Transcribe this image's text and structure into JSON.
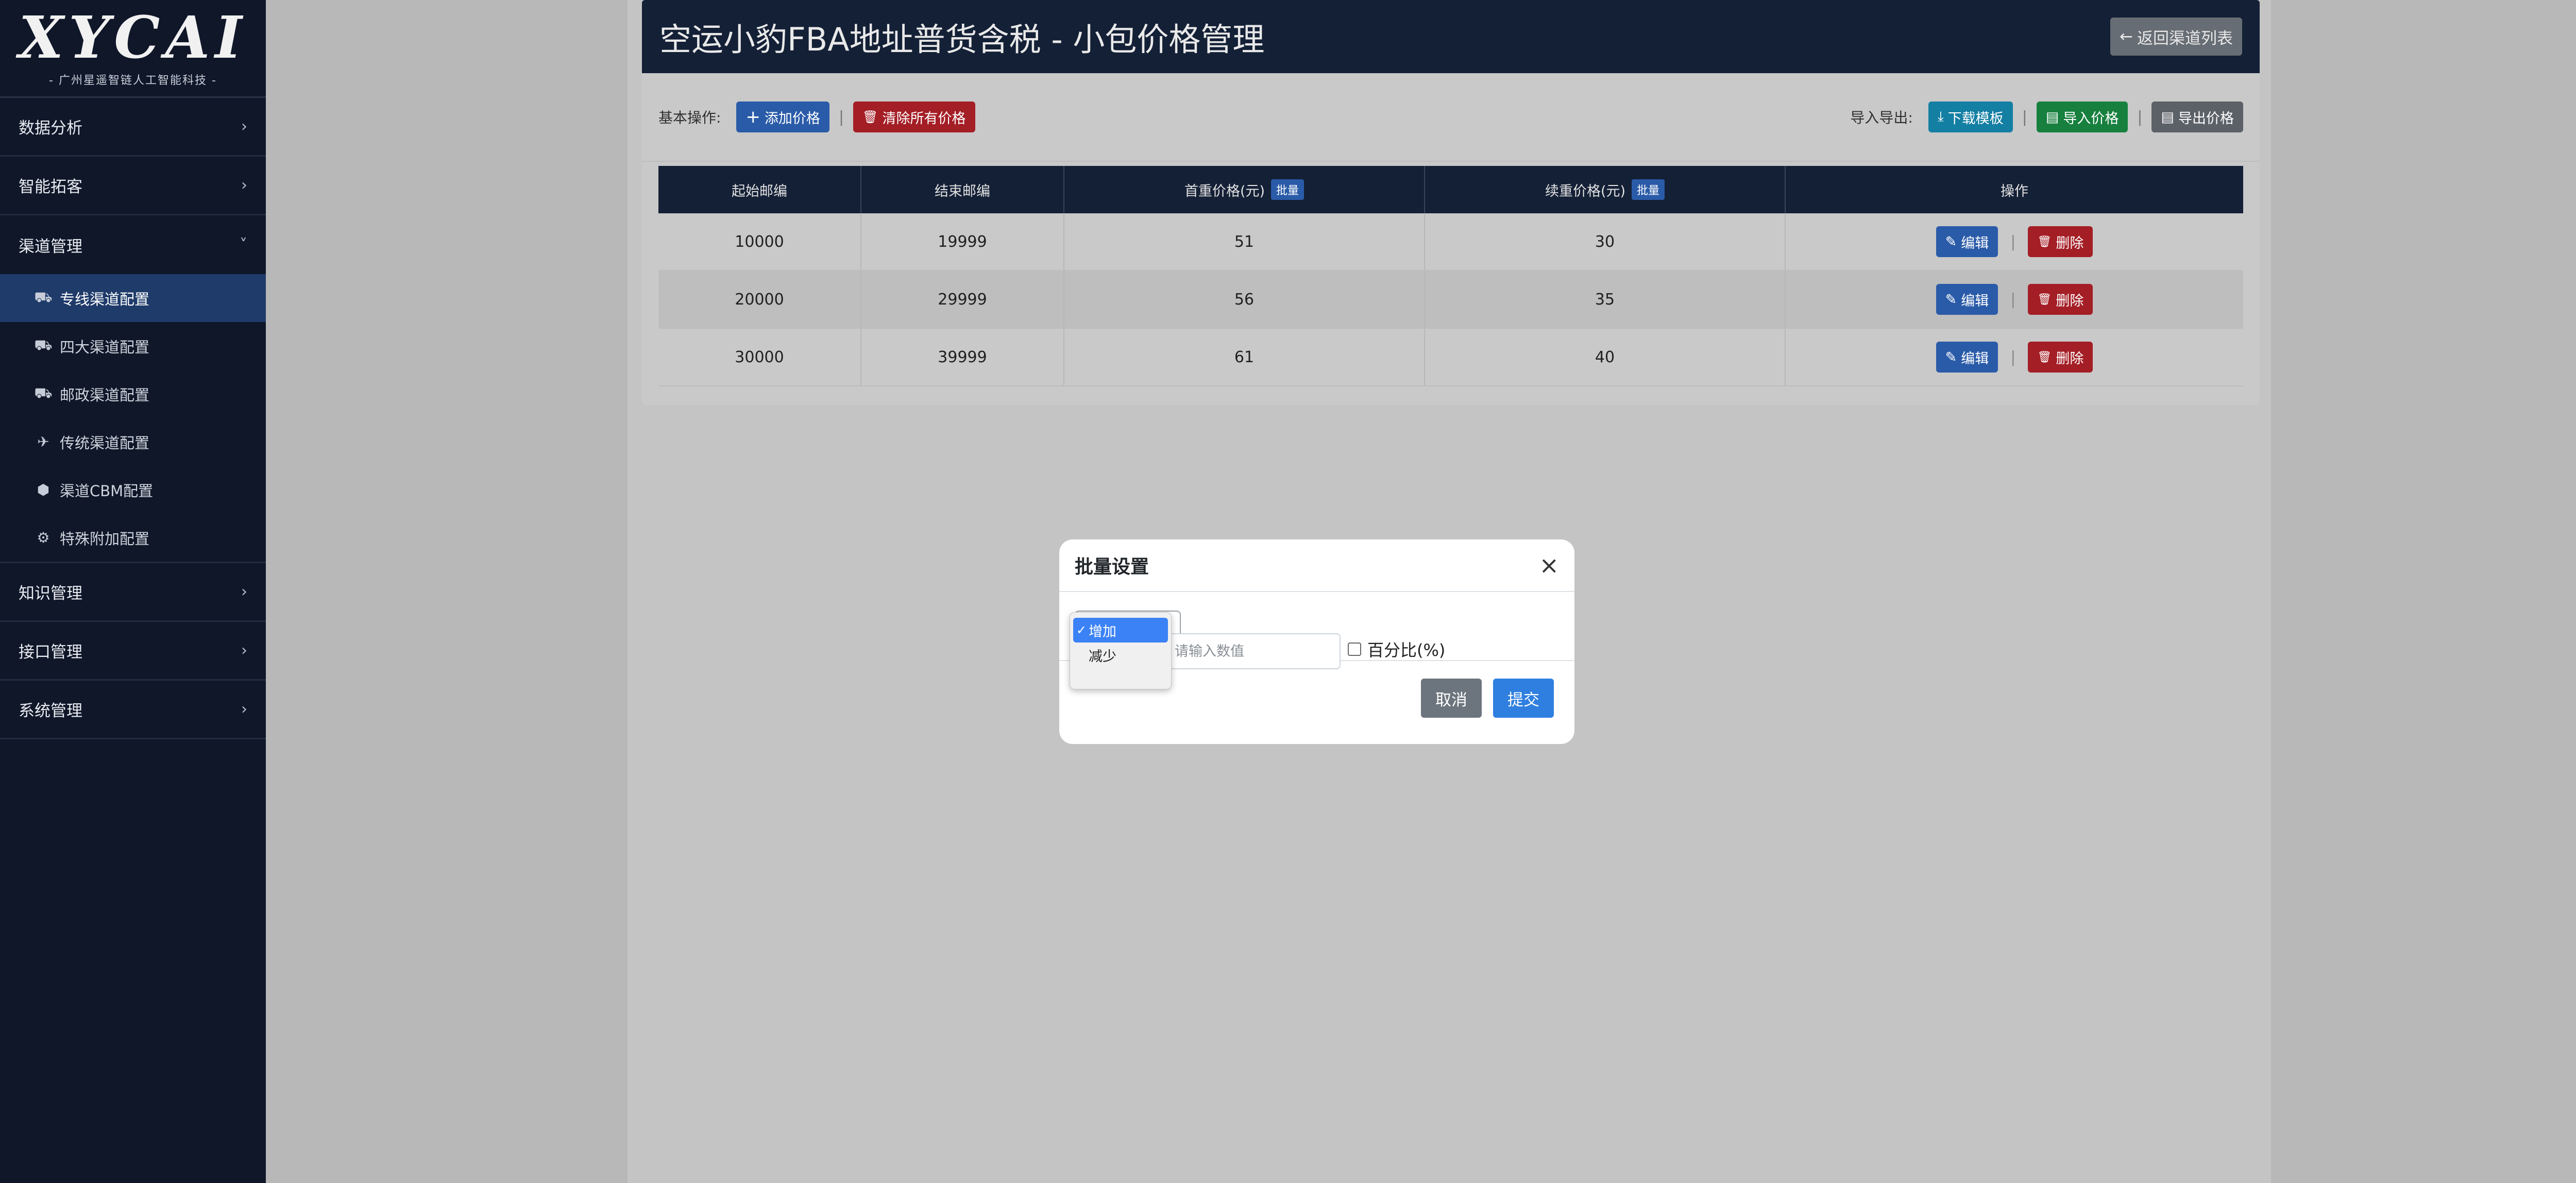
{
  "sidebar": {
    "logo": "XYCAI",
    "logo_sub": "- 广州星遥智链人工智能科技 -",
    "groups": [
      {
        "label": "数据分析",
        "chevron": "›"
      },
      {
        "label": "智能拓客",
        "chevron": "›"
      },
      {
        "label": "渠道管理",
        "chevron": "˅"
      }
    ],
    "channel_items": [
      {
        "label": "专线渠道配置",
        "icon": "truck-icon",
        "glyph": "⛟"
      },
      {
        "label": "四大渠道配置",
        "icon": "truck-icon",
        "glyph": "⛟"
      },
      {
        "label": "邮政渠道配置",
        "icon": "truck-icon",
        "glyph": "⛟"
      },
      {
        "label": "传统渠道配置",
        "icon": "plane-icon",
        "glyph": "✈"
      },
      {
        "label": "渠道CBM配置",
        "icon": "cube-icon",
        "glyph": "⬢"
      },
      {
        "label": "特殊附加配置",
        "icon": "gear-icon",
        "glyph": "⚙"
      }
    ],
    "groups_after": [
      {
        "label": "知识管理",
        "chevron": "›"
      },
      {
        "label": "接口管理",
        "chevron": "›"
      },
      {
        "label": "系统管理",
        "chevron": "›"
      }
    ]
  },
  "header": {
    "title": "空运小豹FBA地址普货含税 - 小包价格管理",
    "back_label": "返回渠道列表",
    "back_icon": "←"
  },
  "toolbar": {
    "basic_label": "基本操作:",
    "add_label": "添加价格",
    "add_icon": "+",
    "clear_label": "清除所有价格",
    "clear_icon": "🗑",
    "io_label": "导入导出:",
    "download_label": "下载模板",
    "download_icon": "⤓",
    "import_label": "导入价格",
    "import_icon": "▤",
    "export_label": "导出价格",
    "export_icon": "▤",
    "sep": "|"
  },
  "table": {
    "headers": [
      "起始邮编",
      "结束邮编",
      "首重价格(元)",
      "续重价格(元)",
      "操作"
    ],
    "batch_badge": "批量",
    "rows": [
      [
        "10000",
        "19999",
        "51",
        "30"
      ],
      [
        "20000",
        "29999",
        "56",
        "35"
      ],
      [
        "30000",
        "39999",
        "61",
        "40"
      ]
    ],
    "edit_label": "编辑",
    "edit_icon": "✎",
    "delete_label": "删除",
    "delete_icon": "🗑"
  },
  "modal": {
    "title": "批量设置",
    "close": "×",
    "options": [
      "增加",
      "减少"
    ],
    "selected_check": "✓",
    "value_placeholder": "请输入数值",
    "percent_label": "百分比(%)",
    "cancel_label": "取消",
    "submit_label": "提交"
  }
}
